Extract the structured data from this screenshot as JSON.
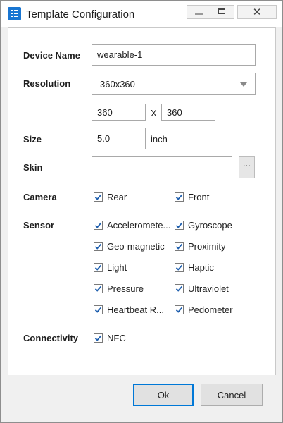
{
  "window": {
    "title": "Template Configuration",
    "icon": "list-icon",
    "controls": {
      "minimize": "minimize-icon",
      "maximize": "maximize-icon",
      "close": "✕"
    }
  },
  "form": {
    "device_name": {
      "label": "Device Name",
      "value": "wearable-1"
    },
    "resolution": {
      "label": "Resolution",
      "selected": "360x360",
      "width": "360",
      "separator": "X",
      "height": "360"
    },
    "size": {
      "label": "Size",
      "value": "5.0",
      "unit": "inch"
    },
    "skin": {
      "label": "Skin",
      "value": "",
      "browse": "···"
    },
    "camera": {
      "label": "Camera",
      "options": [
        {
          "label": "Rear",
          "checked": true
        },
        {
          "label": "Front",
          "checked": true
        }
      ]
    },
    "sensor": {
      "label": "Sensor",
      "options": [
        {
          "label": "Acceleromete...",
          "checked": true
        },
        {
          "label": "Gyroscope",
          "checked": true
        },
        {
          "label": "Geo-magnetic",
          "checked": true
        },
        {
          "label": "Proximity",
          "checked": true
        },
        {
          "label": "Light",
          "checked": true
        },
        {
          "label": "Haptic",
          "checked": true
        },
        {
          "label": "Pressure",
          "checked": true
        },
        {
          "label": "Ultraviolet",
          "checked": true
        },
        {
          "label": "Heartbeat R...",
          "checked": true
        },
        {
          "label": "Pedometer",
          "checked": true
        }
      ]
    },
    "connectivity": {
      "label": "Connectivity",
      "options": [
        {
          "label": "NFC",
          "checked": true
        }
      ]
    }
  },
  "buttons": {
    "ok": "Ok",
    "cancel": "Cancel"
  },
  "colors": {
    "accent": "#0078d7",
    "checkmark": "#1f5fae",
    "app_icon": "#1976d2"
  }
}
